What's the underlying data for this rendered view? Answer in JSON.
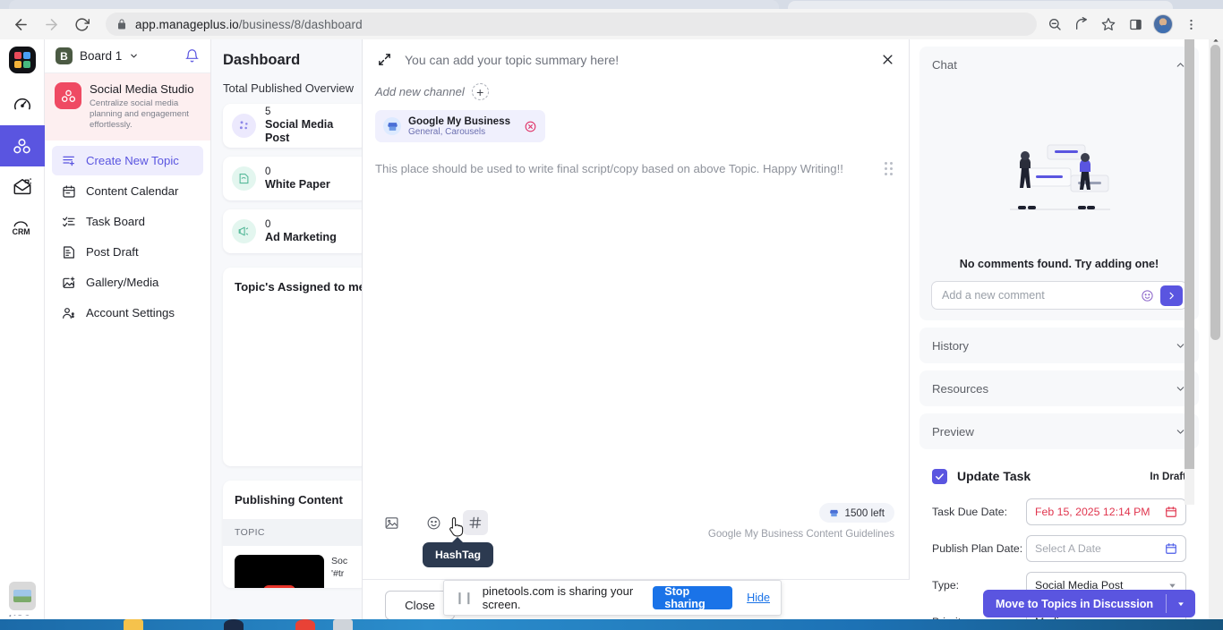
{
  "browser": {
    "url_secure_host": "app.manageplus.io",
    "url_path": "/business/8/dashboard",
    "back_icon": "back-arrow-icon",
    "forward_icon": "forward-arrow-icon",
    "reload_icon": "reload-icon",
    "lock_icon": "lock-icon",
    "zoom_out_icon": "zoom-out-icon",
    "share_icon": "share-icon",
    "bookmark_icon": "star-icon",
    "sidepanel_icon": "side-panel-icon",
    "profile_icon": "profile-avatar",
    "menu_icon": "three-dot-menu-icon"
  },
  "rail": {
    "items": [
      {
        "name": "app-logo",
        "label": ""
      },
      {
        "name": "speedometer",
        "label": ""
      },
      {
        "name": "social-studio",
        "label": ""
      },
      {
        "name": "campaign-mail",
        "label": ""
      },
      {
        "name": "crm",
        "label": "CRM"
      }
    ],
    "bottom_label": "USC"
  },
  "sidebar": {
    "board": {
      "badge": "B",
      "name": "Board 1",
      "caret": "chevron-down-icon",
      "bell": "notification-bell-icon"
    },
    "studio": {
      "title": "Social Media Studio",
      "subtitle": "Centralize social media planning and engagement effortlessly."
    },
    "items": [
      {
        "label": "Create New Topic",
        "icon": "create-topic-icon",
        "active": true
      },
      {
        "label": "Content Calendar",
        "icon": "calendar-icon",
        "active": false
      },
      {
        "label": "Task Board",
        "icon": "task-list-icon",
        "active": false
      },
      {
        "label": "Post Draft",
        "icon": "draft-edit-icon",
        "active": false
      },
      {
        "label": "Gallery/Media",
        "icon": "gallery-add-icon",
        "active": false
      },
      {
        "label": "Account Settings",
        "icon": "account-settings-icon",
        "active": false
      }
    ]
  },
  "dashboard": {
    "title": "Dashboard",
    "overview_label": "Total Published Overview",
    "stats": [
      {
        "count": "5",
        "label": "Social Media Post",
        "icon": "social-post-icon",
        "color": "#ece9fd"
      },
      {
        "count": "0",
        "label": "White Paper",
        "icon": "white-paper-icon",
        "color": "#e3f6ef"
      },
      {
        "count": "0",
        "label": "Ad Marketing",
        "icon": "ad-marketing-icon",
        "color": "#e3f6ef"
      }
    ],
    "assigned_title": "Topic's Assigned to me",
    "publishing": {
      "title": "Publishing Content",
      "column_header": "TOPIC",
      "row_text_1": "Soc",
      "row_text_2": "'#tr"
    }
  },
  "modal": {
    "expand_icon": "expand-diagonal-icon",
    "summary_placeholder": "You can add your topic summary here!",
    "close_icon": "close-x-icon",
    "add_channel_label": "Add new channel",
    "add_channel_plus": "+",
    "channel": {
      "name": "Google My Business",
      "sub": "General, Carousels",
      "icon": "google-my-business-icon",
      "remove_icon": "remove-circle-icon"
    },
    "editor_placeholder": "This place should be used to write final script/copy based on above Topic. Happy Writing!!",
    "drag_handle": "drag-handle-icon",
    "toolbar": {
      "image_icon": "insert-image-icon",
      "emoji_icon": "emoji-icon",
      "hashtag_icon": "hashtag-icon",
      "tooltip": "HashTag"
    },
    "counter": "1500 left",
    "counter_icon": "google-my-business-icon",
    "guidelines": "Google My Business Content Guidelines",
    "close_button": "Close"
  },
  "right_panel": {
    "sections": [
      {
        "label": "Chat",
        "state": "expanded",
        "caret": "chevron-up-icon"
      },
      {
        "label": "History",
        "state": "collapsed",
        "caret": "chevron-down-icon"
      },
      {
        "label": "Resources",
        "state": "collapsed",
        "caret": "chevron-down-icon"
      },
      {
        "label": "Preview",
        "state": "collapsed",
        "caret": "chevron-down-icon"
      }
    ],
    "chat": {
      "empty_text": "No comments found. Try adding one!",
      "comment_placeholder": "Add a new comment",
      "emoji_icon": "emoji-icon",
      "send_icon": "send-arrow-icon",
      "illustration": "chat-people-illustration"
    },
    "task": {
      "title": "Update Task",
      "checkbox": "checked",
      "status": "In Draft",
      "fields": [
        {
          "label": "Task Due Date:",
          "value": "Feb 15, 2025 12:14 PM",
          "style": "red",
          "icon": "calendar-red-icon"
        },
        {
          "label": "Publish Plan Date:",
          "value": "Select A Date",
          "style": "placeholder",
          "icon": "calendar-blue-icon"
        },
        {
          "label": "Type:",
          "value": "Social Media Post",
          "style": "normal",
          "icon": "chevron-down-icon"
        },
        {
          "label": "Priority:",
          "value": "Medium",
          "style": "normal",
          "icon": "chevron-down-icon"
        }
      ]
    }
  },
  "share_bar": {
    "pause_icon": "pause-icon",
    "message": "pinetools.com is sharing your screen.",
    "stop_label": "Stop sharing",
    "hide_label": "Hide"
  },
  "cta": {
    "label": "Move to Topics in Discussion",
    "caret": "chevron-down-icon"
  },
  "colors": {
    "accent": "#5a55e0",
    "danger": "#e0354e",
    "brand_pink": "#ef4a63",
    "blue_link": "#1a73e8"
  }
}
